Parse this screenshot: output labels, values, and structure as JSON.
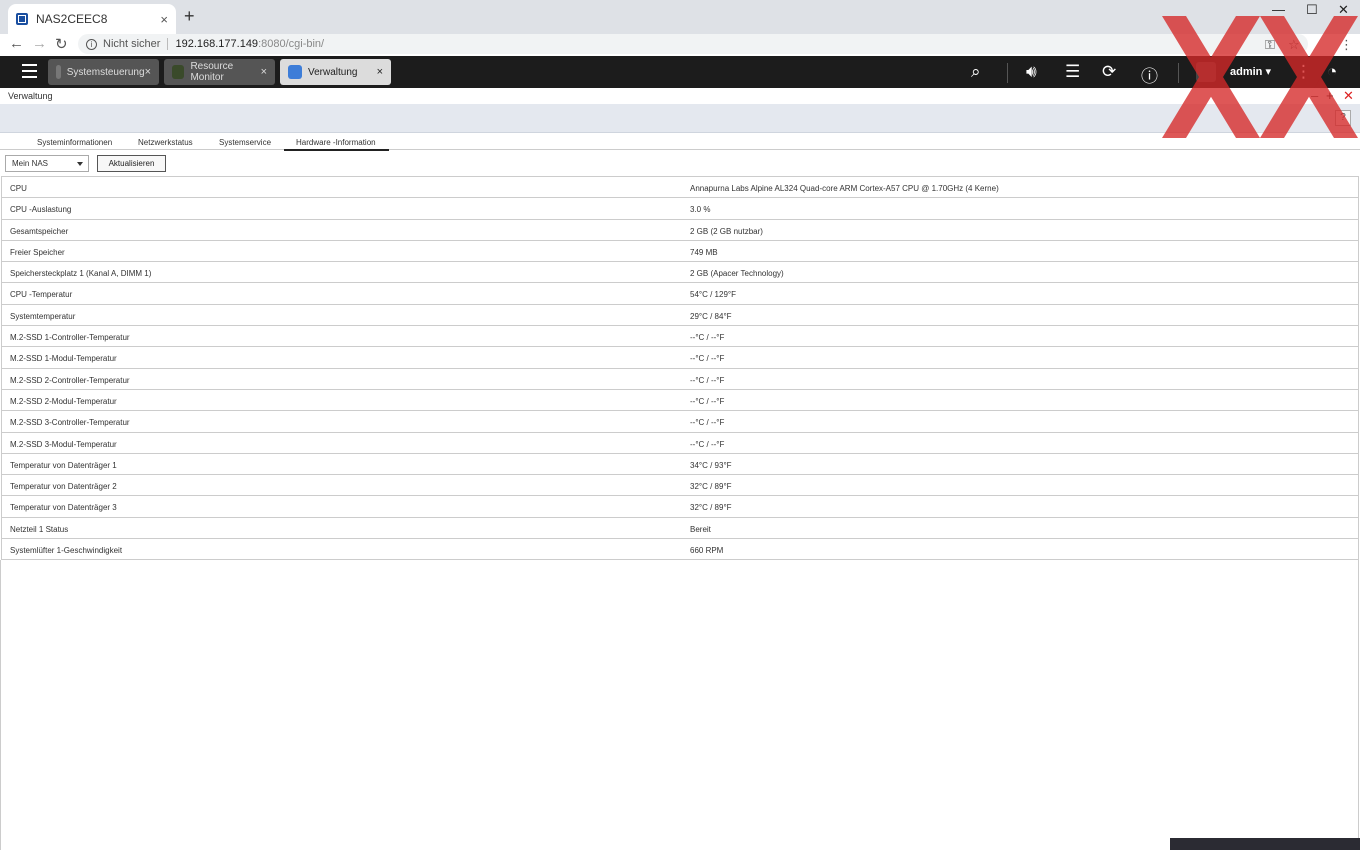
{
  "browser": {
    "tab_title": "NAS2CEEC8",
    "tab_close": "×",
    "new_tab": "+",
    "security_label": "Nicht sicher",
    "url_host": "192.168.177.149",
    "url_path": ":8080/cgi-bin/"
  },
  "topbar": {
    "tabs": [
      {
        "label": "Systemsteuerung"
      },
      {
        "label": "Resource Monitor"
      },
      {
        "label": "Verwaltung"
      }
    ],
    "user": "admin ▾"
  },
  "window": {
    "title": "Verwaltung",
    "help": "?"
  },
  "subtabs": [
    {
      "label": "Systeminformationen"
    },
    {
      "label": "Netzwerkstatus"
    },
    {
      "label": "Systemservice"
    },
    {
      "label": "Hardware -Information"
    }
  ],
  "toolbar": {
    "device_select": "Mein NAS",
    "refresh_label": "Aktualisieren"
  },
  "hardware_rows": [
    {
      "key": "CPU",
      "value": "Annapurna Labs Alpine AL324 Quad-core ARM Cortex-A57 CPU @ 1.70GHz (4 Kerne)"
    },
    {
      "key": "CPU -Auslastung",
      "value": "3.0 %"
    },
    {
      "key": "Gesamtspeicher",
      "value": "2 GB (2 GB nutzbar)"
    },
    {
      "key": "Freier Speicher",
      "value": "749 MB"
    },
    {
      "key": "Speichersteckplatz 1 (Kanal A, DIMM 1)",
      "value": "2 GB (Apacer Technology)"
    },
    {
      "key": "CPU -Temperatur",
      "value": "54°C / 129°F"
    },
    {
      "key": "Systemtemperatur",
      "value": "29°C / 84°F"
    },
    {
      "key": "M.2-SSD 1-Controller-Temperatur",
      "value": "--°C / --°F"
    },
    {
      "key": "M.2-SSD 1-Modul-Temperatur",
      "value": "--°C / --°F"
    },
    {
      "key": "M.2-SSD 2-Controller-Temperatur",
      "value": "--°C / --°F"
    },
    {
      "key": "M.2-SSD 2-Modul-Temperatur",
      "value": "--°C / --°F"
    },
    {
      "key": "M.2-SSD 3-Controller-Temperatur",
      "value": "--°C / --°F"
    },
    {
      "key": "M.2-SSD 3-Modul-Temperatur",
      "value": "--°C / --°F"
    },
    {
      "key": "Temperatur von Datenträger 1",
      "value": "34°C / 93°F"
    },
    {
      "key": "Temperatur von Datenträger 2",
      "value": "32°C / 89°F"
    },
    {
      "key": "Temperatur von Datenträger 3",
      "value": "32°C / 89°F"
    },
    {
      "key": "Netzteil 1 Status",
      "value": "Bereit"
    },
    {
      "key": "Systemlüfter 1-Geschwindigkeit",
      "value": "660 RPM"
    }
  ],
  "colors": {
    "topbar": "#1c1c1c",
    "watermark": "#d62828"
  }
}
